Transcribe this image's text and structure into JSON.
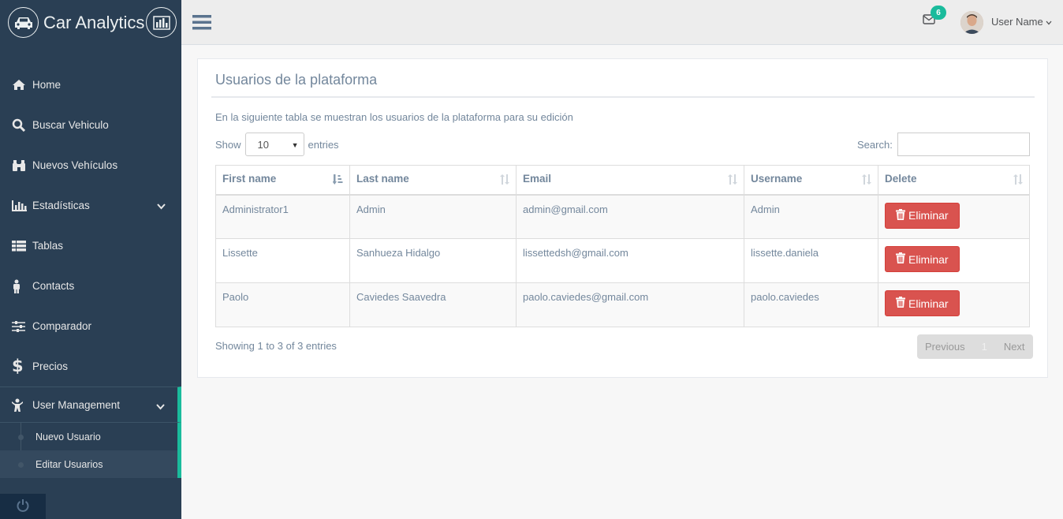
{
  "brand": {
    "title": "Car Analytics"
  },
  "sidebar": {
    "items": [
      {
        "label": "Home",
        "icon": "home-icon"
      },
      {
        "label": "Buscar Vehiculo",
        "icon": "search-icon"
      },
      {
        "label": "Nuevos Vehículos",
        "icon": "binoculars-icon"
      },
      {
        "label": "Estadísticas",
        "icon": "bar-chart-icon"
      },
      {
        "label": "Tablas",
        "icon": "table-icon"
      },
      {
        "label": "Contacts",
        "icon": "person-icon"
      },
      {
        "label": "Comparador",
        "icon": "sliders-icon"
      },
      {
        "label": "Precios",
        "icon": "dollar-icon"
      },
      {
        "label": "User Management",
        "icon": "child-icon"
      }
    ],
    "submenu": [
      {
        "label": "Nuevo Usuario"
      },
      {
        "label": "Editar Usuarios"
      }
    ]
  },
  "topnav": {
    "notification_count": "6",
    "user_name": "User Name"
  },
  "panel": {
    "title": "Usuarios de la plataforma",
    "description": "En la siguiente tabla se muestran los usuarios de la plataforma para su edición",
    "show_label": "Show",
    "entries_label": "entries",
    "page_size": "10",
    "search_label": "Search:",
    "search_value": ""
  },
  "table": {
    "columns": [
      "First name",
      "Last name",
      "Email",
      "Username",
      "Delete"
    ],
    "rows": [
      {
        "first": "Administrator1",
        "last": "Admin",
        "email": "admin@gmail.com",
        "username": "Admin",
        "action": "Eliminar"
      },
      {
        "first": "Lissette",
        "last": "Sanhueza Hidalgo",
        "email": "lissettedsh@gmail.com",
        "username": "lissette.daniela",
        "action": "Eliminar"
      },
      {
        "first": "Paolo",
        "last": "Caviedes Saavedra",
        "email": "paolo.caviedes@gmail.com",
        "username": "paolo.caviedes",
        "action": "Eliminar"
      }
    ]
  },
  "footer": {
    "info": "Showing 1 to 3 of 3 entries",
    "previous": "Previous",
    "page": "1",
    "next": "Next"
  },
  "colors": {
    "sidebar": "#2A3F54",
    "accent": "#1ABB9C",
    "danger": "#D9534F"
  }
}
